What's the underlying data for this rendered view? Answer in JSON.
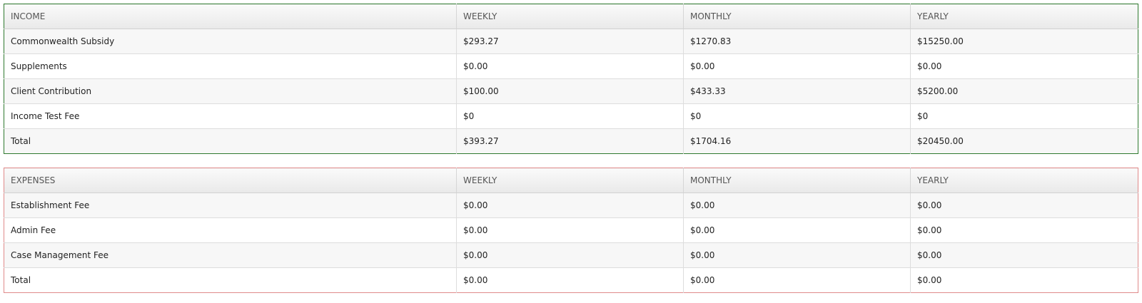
{
  "income": {
    "headers": [
      "INCOME",
      "WEEKLY",
      "MONTHLY",
      "YEARLY"
    ],
    "rows": [
      [
        "Commonwealth Subsidy",
        "$293.27",
        "$1270.83",
        "$15250.00"
      ],
      [
        "Supplements",
        "$0.00",
        "$0.00",
        "$0.00"
      ],
      [
        "Client Contribution",
        "$100.00",
        "$433.33",
        "$5200.00"
      ],
      [
        "Income Test Fee",
        "$0",
        "$0",
        "$0"
      ],
      [
        "Total",
        "$393.27",
        "$1704.16",
        "$20450.00"
      ]
    ],
    "border_color": "#2f7a2f"
  },
  "expenses": {
    "headers": [
      "EXPENSES",
      "WEEKLY",
      "MONTHLY",
      "YEARLY"
    ],
    "rows": [
      [
        "Establishment Fee",
        "$0.00",
        "$0.00",
        "$0.00"
      ],
      [
        "Admin Fee",
        "$0.00",
        "$0.00",
        "$0.00"
      ],
      [
        "Case Management Fee",
        "$0.00",
        "$0.00",
        "$0.00"
      ],
      [
        "Total",
        "$0.00",
        "$0.00",
        "$0.00"
      ]
    ],
    "border_color": "#e08a8a"
  }
}
